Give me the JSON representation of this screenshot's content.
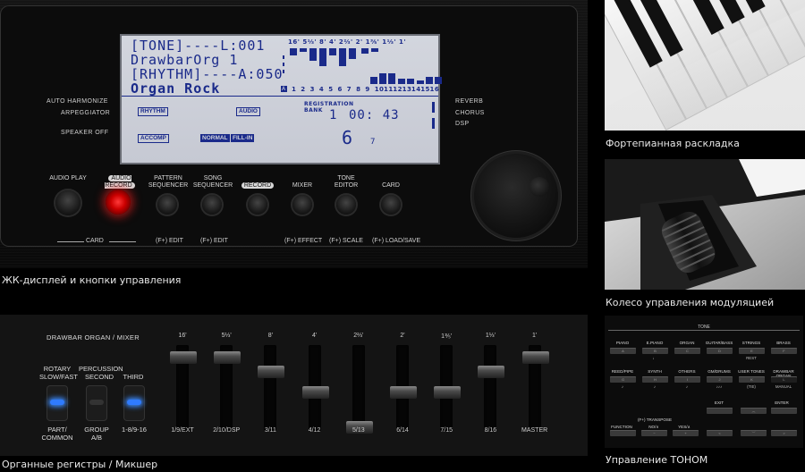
{
  "lcd": {
    "line1": "[TONE]----L:001",
    "line2": "DrawbarOrg 1",
    "line3": "[RHYTHM]----A:050",
    "line4": "Organ Rock",
    "footages": "16' 5⅓' 8' 4' 2⅔' 2' 1⅗' 1⅓' 1'",
    "channels": [
      "1",
      "2",
      "3",
      "4",
      "5",
      "6",
      "7",
      "8",
      "9",
      "10",
      "11",
      "12",
      "13",
      "14",
      "15",
      "16"
    ],
    "ch_a": "A",
    "rhythm": "RHYTHM",
    "audio": "AUDIO",
    "registration_bank": "REGISTRATION\nBANK",
    "measure": "1",
    "time": "00: 43",
    "accomp": "ACCOMP",
    "normal": "NORMAL",
    "fill_in": "FILL-IN",
    "big_num": "6",
    "small_num": "7"
  },
  "left_side": [
    "AUTO HARMONIZE",
    "ARPEGGIATOR",
    "SPEAKER OFF"
  ],
  "right_side": [
    "REVERB",
    "CHORUS",
    "DSP"
  ],
  "buttons": {
    "audio_play": "AUDIO PLAY",
    "audio_record": "AUDIO RECORD",
    "pattern_sequencer": "PATTERN\nSEQUENCER",
    "song_sequencer": "SONG\nSEQUENCER",
    "record": "RECORD",
    "mixer": "MIXER",
    "tone_editor": "TONE\nEDITOR",
    "card": "CARD"
  },
  "sub_labels": {
    "card": "CARD",
    "edit1": "(F+) EDIT",
    "edit2": "(F+) EDIT",
    "effect": "(F+) EFFECT",
    "scale": "(F+) SCALE",
    "loadsave": "(F+) LOAD/SAVE"
  },
  "captions": {
    "lcd": "ЖК-дисплей и кнопки управления",
    "keyboard": "Фортепианная раскладка",
    "wheel": "Колесо управления модуляцией",
    "mixer": "Органные регистры / Микшер",
    "tone": "Управление ТОНОМ"
  },
  "mixer": {
    "title": "DRAWBAR ORGAN / MIXER",
    "rotary": "ROTARY\nSLOW/FAST",
    "percussion": "PERCUSSION\nSECOND",
    "third": "THIRD",
    "part_common": "PART/\nCOMMON",
    "group_ab": "GROUP\nA/B",
    "range": "1-8/9-16",
    "faders": [
      {
        "top": "16'",
        "bottom": "1/9/EXT",
        "level": 0.08
      },
      {
        "top": "5⅓'",
        "bottom": "2/10/DSP",
        "level": 0.08
      },
      {
        "top": "8'",
        "bottom": "3/11",
        "level": 0.25
      },
      {
        "top": "4'",
        "bottom": "4/12",
        "level": 0.5
      },
      {
        "top": "2⅔'",
        "bottom": "5/13",
        "level": 0.92
      },
      {
        "top": "2'",
        "bottom": "6/14",
        "level": 0.5
      },
      {
        "top": "1⅗'",
        "bottom": "7/15",
        "level": 0.5
      },
      {
        "top": "1⅓'",
        "bottom": "8/16",
        "level": 0.25
      },
      {
        "top": "1'",
        "bottom": "MASTER",
        "level": 0.08
      }
    ]
  },
  "tone_panel": {
    "title": "TONE",
    "row1": [
      {
        "label": "PIANO",
        "key": "A"
      },
      {
        "label": "E.PIANO",
        "key": "B"
      },
      {
        "label": "ORGAN",
        "key": "C"
      },
      {
        "label": "GUITAR/BASS",
        "key": "D"
      },
      {
        "label": "STRINGS",
        "key": "E"
      },
      {
        "label": "BRASS",
        "key": "F"
      }
    ],
    "row1_sub": [
      "",
      "♩",
      "",
      "",
      "REST",
      ""
    ],
    "row2": [
      {
        "label": "REED/PIPE",
        "key": "G"
      },
      {
        "label": "SYNTH",
        "key": "H"
      },
      {
        "label": "OTHERS",
        "key": "I"
      },
      {
        "label": "GM/DRUMS",
        "key": "J"
      },
      {
        "label": "USER TONES",
        "key": "K"
      },
      {
        "label": "DRAWBAR ORGAN",
        "key": "L"
      }
    ],
    "row2_sub": [
      "♪",
      "♪",
      "♪",
      "♪♪♪",
      "(TIE)",
      "MANUAL"
    ],
    "exit": "EXIT",
    "enter": "ENTER",
    "transpose": "(F+) TRANSPOSE",
    "function": "FUNCTION",
    "no": "NO/∨",
    "yes": "YES/∧",
    "minus": "−",
    "plus": "+"
  }
}
